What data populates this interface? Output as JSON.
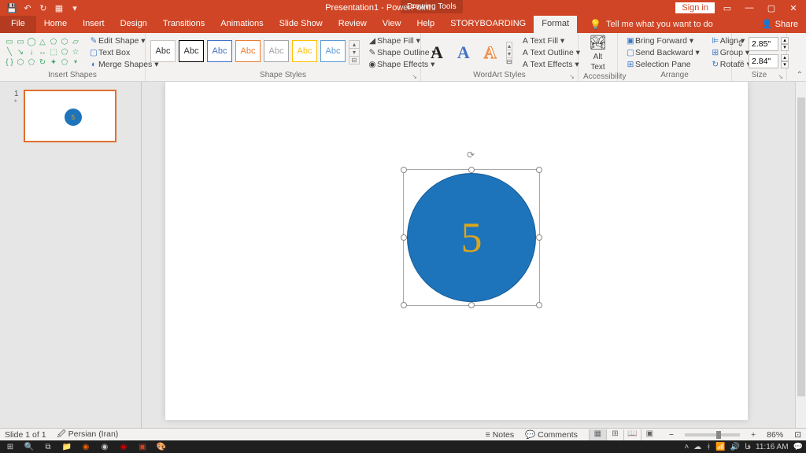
{
  "titlebar": {
    "doc_title": "Presentation1 - PowerPoint",
    "context_tab": "Drawing Tools",
    "signin": "Sign in"
  },
  "tabs": {
    "file": "File",
    "items": [
      "Home",
      "Insert",
      "Design",
      "Transitions",
      "Animations",
      "Slide Show",
      "Review",
      "View",
      "Help",
      "STORYBOARDING",
      "Format"
    ],
    "tell_me": "Tell me what you want to do",
    "share": "Share"
  },
  "ribbon": {
    "insert_shapes": {
      "label": "Insert Shapes",
      "edit_shape": "Edit Shape",
      "text_box": "Text Box",
      "merge": "Merge Shapes"
    },
    "shape_styles": {
      "label": "Shape Styles",
      "abc": "Abc",
      "fill": "Shape Fill",
      "outline": "Shape Outline",
      "effects": "Shape Effects"
    },
    "wordart": {
      "label": "WordArt Styles",
      "letter": "A",
      "fill": "Text Fill",
      "outline": "Text Outline",
      "effects": "Text Effects"
    },
    "accessibility": {
      "label": "Accessibility",
      "alt1": "Alt",
      "alt2": "Text"
    },
    "arrange": {
      "label": "Arrange",
      "fwd": "Bring Forward",
      "back": "Send Backward",
      "selpane": "Selection Pane",
      "align": "Align",
      "group": "Group",
      "rotate": "Rotate"
    },
    "size": {
      "label": "Size",
      "height": "2.85\"",
      "width": "2.84\""
    }
  },
  "slide_panel": {
    "num": "1",
    "star": "*"
  },
  "canvas": {
    "shape_text": "5",
    "thumb_text": "5"
  },
  "statusbar": {
    "slide": "Slide 1 of 1",
    "lang": "Persian (Iran)",
    "notes": "Notes",
    "comments": "Comments",
    "zoom": "86%",
    "zoom_plus": "+",
    "zoom_minus": "−"
  },
  "taskbar": {
    "time": "11:16 AM",
    "lang": "فا"
  }
}
